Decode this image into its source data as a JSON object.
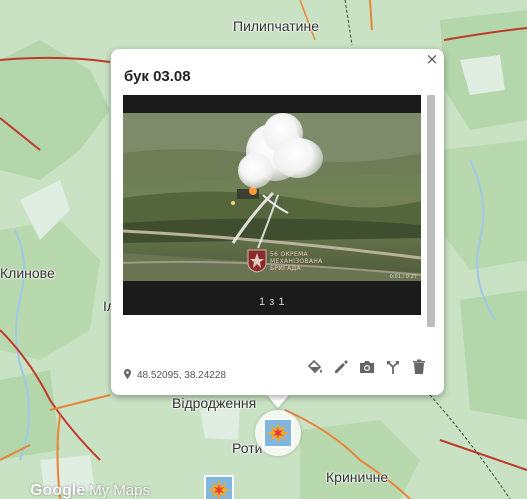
{
  "map": {
    "places": [
      {
        "name": "Пилипчатине"
      },
      {
        "name": "Клинове"
      },
      {
        "name": "Іл"
      },
      {
        "name": "Відродження"
      },
      {
        "name": "Роти"
      },
      {
        "name": "Криничне"
      }
    ],
    "colors": {
      "land": "#c9e2c3",
      "forest": "#a9d1a0",
      "road_major": "#c0392b",
      "road_secondary": "#e8833a",
      "water": "#9fc9e6",
      "border": "#3b4a3b"
    }
  },
  "popup": {
    "title": "бук 03.08",
    "close_label": "×",
    "media": {
      "counter": "1 з 1",
      "overlay_text": "56 ОКРЕМА МЕХАНІЗОВАНА БРИГАДА",
      "control_text": "0:01 / 0:27"
    },
    "coordinates": "48.52095, 38.24228",
    "tools": [
      {
        "icon": "paint-bucket-icon"
      },
      {
        "icon": "pencil-icon"
      },
      {
        "icon": "camera-icon"
      },
      {
        "icon": "directions-icon"
      },
      {
        "icon": "trash-icon"
      }
    ]
  },
  "branding": {
    "google": "Google",
    "my_maps": "My Maps"
  },
  "markers": [
    {
      "icon": "explosion-icon"
    },
    {
      "icon": "explosion-icon"
    }
  ]
}
